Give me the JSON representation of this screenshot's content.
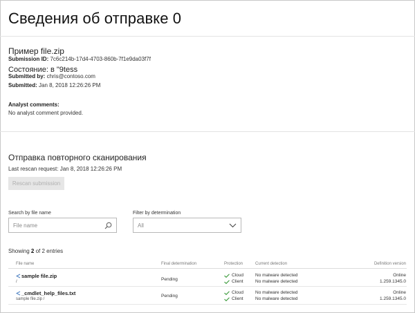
{
  "page": {
    "title": "Сведения об отправке 0"
  },
  "submission": {
    "file_title": "Пример file.zip",
    "id_label": "Submission ID:",
    "id_value": "7c6c214b-17d4-4703-860b-7f1e9da03f7f",
    "state": "Состояние: в \"9tess",
    "submitted_by_label": "Submitted by:",
    "submitted_by_value": "chris@contoso.com",
    "submitted_label": "Submitted:",
    "submitted_value": "Jan 8, 2018 12:26:26 PM"
  },
  "analyst": {
    "label": "Analyst comments:",
    "text": "No analyst comment provided."
  },
  "rescan": {
    "title": "Отправка повторного сканирования",
    "last_request": "Last rescan request: Jan 8, 2018 12:26:26 PM",
    "button_label": "Rescan submission"
  },
  "search": {
    "label": "Search by file name",
    "placeholder": "File name"
  },
  "filter": {
    "label": "Filter by determination",
    "value": "All"
  },
  "entries": {
    "prefix": "Showing ",
    "shown": "2",
    "suffix": " of 2 entries"
  },
  "table": {
    "headers": {
      "file_name": "File name",
      "final_determination": "Final determination",
      "protection": "Protection",
      "current_detection": "Current detection",
      "definition_version": "Definition version"
    },
    "rows": [
      {
        "name": "sample file.zip",
        "path": "/",
        "determination": "Pending",
        "protection": [
          "Cloud",
          "Client"
        ],
        "detection": [
          "No malware detected",
          "No malware detected"
        ],
        "definition": [
          "Online",
          "1.259.1345.0"
        ]
      },
      {
        "name": "_cmdlet_help_files.txt",
        "path": "sample file.zip /",
        "determination": "Pending",
        "protection": [
          "Cloud",
          "Client"
        ],
        "detection": [
          "No malware detected",
          "No malware detected"
        ],
        "definition": [
          "Online",
          "1.259.1345.0"
        ]
      }
    ]
  },
  "colors": {
    "check_green": "#3a9a3a",
    "file_icon_blue": "#4a7fc1",
    "button_disabled_bg": "#e6e6e6"
  }
}
